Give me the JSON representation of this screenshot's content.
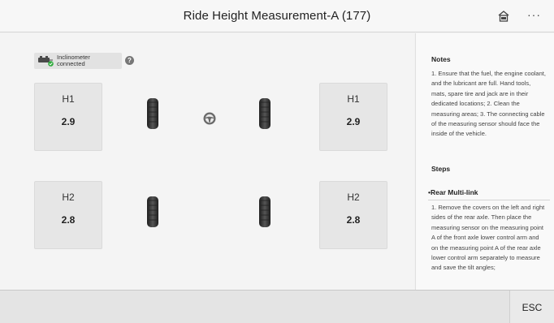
{
  "header": {
    "title": "Ride Height Measurement-A (177)",
    "home_icon": "home-icon",
    "more_label": "···"
  },
  "status": {
    "text": "Inclinometer connected",
    "icon": "inclinometer-connected-icon",
    "status_color": "#2eaa3c"
  },
  "help_label": "?",
  "measurements": {
    "front_left": {
      "label": "H1",
      "value": "2.9"
    },
    "front_right": {
      "label": "H1",
      "value": "2.9"
    },
    "rear_left": {
      "label": "H2",
      "value": "2.8"
    },
    "rear_right": {
      "label": "H2",
      "value": "2.8"
    }
  },
  "notes": {
    "title": "Notes",
    "text": "1. Ensure that the fuel, the engine coolant, and the lubricant are full. Hand tools, mats, spare tire and jack are in their dedicated locations; 2. Clean the measuring areas; 3. The connecting cable of the measuring sensor should face the inside of the vehicle."
  },
  "steps": {
    "title": "Steps",
    "subtitle": "•Rear Multi-link",
    "text": "1. Remove the covers on the left and right sides of the rear axle. Then place the measuring sensor on the measuring point A of the front axle lower control arm and on the measuring point A of the rear axle lower control arm separately to measure and save the tilt angles;"
  },
  "footer": {
    "esc_label": "ESC"
  }
}
